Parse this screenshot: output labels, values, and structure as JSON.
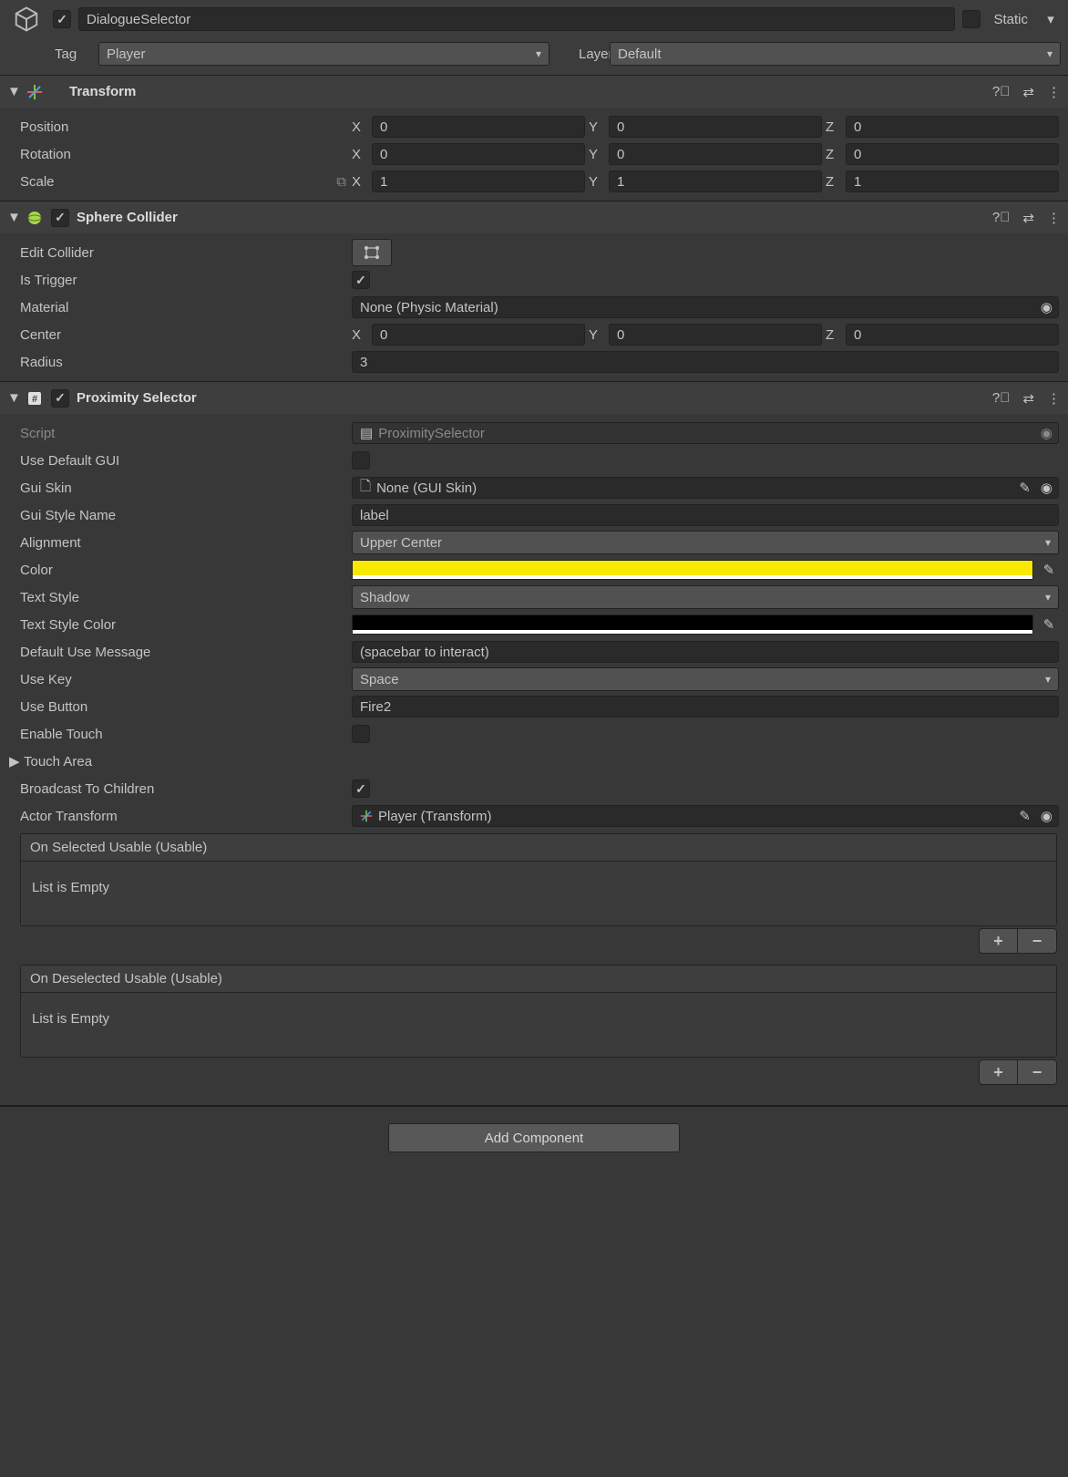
{
  "header": {
    "name": "DialogueSelector",
    "staticLabel": "Static",
    "staticChecked": false,
    "activeChecked": true
  },
  "tagRow": {
    "tagLabel": "Tag",
    "tagValue": "Player",
    "layerLabel": "Layer",
    "layerValue": "Default"
  },
  "transform": {
    "title": "Transform",
    "positionLabel": "Position",
    "rotationLabel": "Rotation",
    "scaleLabel": "Scale",
    "position": {
      "x": "0",
      "y": "0",
      "z": "0"
    },
    "rotation": {
      "x": "0",
      "y": "0",
      "z": "0"
    },
    "scale": {
      "x": "1",
      "y": "1",
      "z": "1"
    }
  },
  "sphereCollider": {
    "title": "Sphere Collider",
    "enabled": true,
    "editColliderLabel": "Edit Collider",
    "isTriggerLabel": "Is Trigger",
    "isTrigger": true,
    "materialLabel": "Material",
    "materialValue": "None (Physic Material)",
    "centerLabel": "Center",
    "center": {
      "x": "0",
      "y": "0",
      "z": "0"
    },
    "radiusLabel": "Radius",
    "radius": "3"
  },
  "proximitySelector": {
    "title": "Proximity Selector",
    "enabled": true,
    "scriptLabel": "Script",
    "scriptValue": "ProximitySelector",
    "useDefaultGUILabel": "Use Default GUI",
    "useDefaultGUI": false,
    "guiSkinLabel": "Gui Skin",
    "guiSkinValue": "None (GUI Skin)",
    "guiStyleNameLabel": "Gui Style Name",
    "guiStyleName": "label",
    "alignmentLabel": "Alignment",
    "alignment": "Upper Center",
    "colorLabel": "Color",
    "color": "#f9e900",
    "textStyleLabel": "Text Style",
    "textStyle": "Shadow",
    "textStyleColorLabel": "Text Style Color",
    "textStyleColor": "#000000",
    "defaultUseMessageLabel": "Default Use Message",
    "defaultUseMessage": "(spacebar to interact)",
    "useKeyLabel": "Use Key",
    "useKey": "Space",
    "useButtonLabel": "Use Button",
    "useButton": "Fire2",
    "enableTouchLabel": "Enable Touch",
    "enableTouch": false,
    "touchAreaLabel": "Touch Area",
    "broadcastLabel": "Broadcast To Children",
    "broadcast": true,
    "actorTransformLabel": "Actor Transform",
    "actorTransformValue": "Player (Transform)",
    "onSelectedTitle": "On Selected Usable (Usable)",
    "onDeselectedTitle": "On Deselected Usable (Usable)",
    "emptyText": "List is Empty"
  },
  "addComponentLabel": "Add Component"
}
